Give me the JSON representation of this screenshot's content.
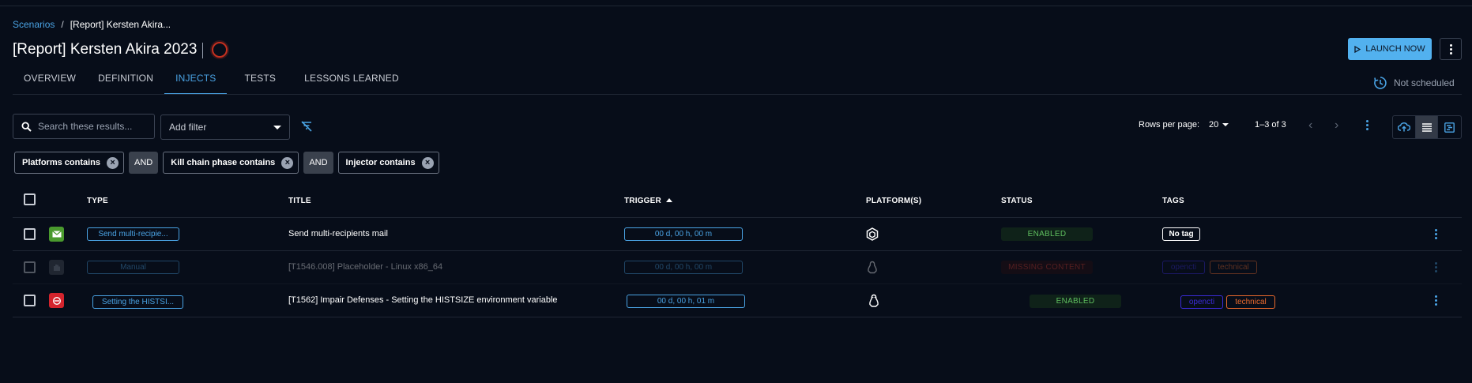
{
  "breadcrumb": {
    "root": "Scenarios",
    "separator": "/",
    "current": "[Report] Kersten Akira..."
  },
  "page": {
    "title": "[Report] Kersten Akira 2023"
  },
  "actions": {
    "launch_label": "LAUNCH NOW"
  },
  "tabs": [
    {
      "label": "OVERVIEW",
      "active": false
    },
    {
      "label": "DEFINITION",
      "active": false
    },
    {
      "label": "INJECTS",
      "active": true
    },
    {
      "label": "TESTS",
      "active": false
    },
    {
      "label": "LESSONS LEARNED",
      "active": false
    }
  ],
  "schedule": {
    "label": "Not scheduled"
  },
  "filters": {
    "search_placeholder": "Search these results...",
    "add_filter_label": "Add filter",
    "chips": [
      {
        "label": "Platforms contains"
      },
      {
        "label": "Kill chain phase contains"
      },
      {
        "label": "Injector contains"
      }
    ],
    "operator": "AND"
  },
  "pagination": {
    "rows_per_page_label": "Rows per page:",
    "rows_per_page": "20",
    "range": "1–3 of 3"
  },
  "table": {
    "columns": {
      "type": "TYPE",
      "title": "TITLE",
      "trigger": "TRIGGER",
      "platforms": "PLATFORM(S)",
      "status": "STATUS",
      "tags": "TAGS"
    },
    "rows": [
      {
        "type": "Send multi-recipie...",
        "type_icon": "mail-icon",
        "type_icon_color": "#4a9a2e",
        "title": "Send multi-recipients mail",
        "trigger": "00 d, 00 h, 00 m",
        "platform_icon": "internal-platform-icon",
        "status": "ENABLED",
        "status_color": "#5fbf5f",
        "tags": [
          {
            "label": "No tag",
            "color": "#ffffff"
          }
        ],
        "disabled": false
      },
      {
        "type": "Manual",
        "type_icon": "manual-icon",
        "type_icon_color": "#4a4f58",
        "title": "[T1546.008] Placeholder - Linux x86_64",
        "trigger": "00 d, 00 h, 00 m",
        "platform_icon": "linux-penguin-icon",
        "status": "MISSING CONTENT",
        "status_color": "#d33a2c",
        "tags": [
          {
            "label": "opencti",
            "color": "#3b2bd6"
          },
          {
            "label": "technical",
            "color": "#e9692c"
          }
        ],
        "disabled": true
      },
      {
        "type": "Setting the HISTSI...",
        "type_icon": "caldera-icon",
        "type_icon_color": "#d4242d",
        "title": "[T1562] Impair Defenses - Setting the HISTSIZE environment variable",
        "trigger": "00 d, 00 h, 01 m",
        "platform_icon": "linux-penguin-icon",
        "status": "ENABLED",
        "status_color": "#5fbf5f",
        "tags": [
          {
            "label": "opencti",
            "color": "#3b2bd6"
          },
          {
            "label": "technical",
            "color": "#e9692c"
          }
        ],
        "disabled": false
      }
    ]
  }
}
